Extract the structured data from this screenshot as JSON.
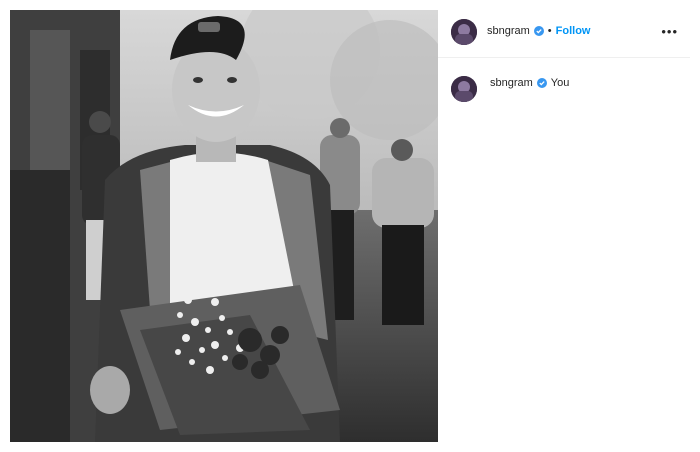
{
  "post": {
    "image": {
      "description_icon": "photo"
    }
  },
  "header": {
    "username": "sbngram",
    "separator": "•",
    "follow_label": "Follow",
    "more_label": "•••"
  },
  "caption": {
    "username": "sbngram",
    "text": "You"
  },
  "colors": {
    "follow": "#0095f6",
    "verified": "#3897f0",
    "divider": "#efefef"
  }
}
